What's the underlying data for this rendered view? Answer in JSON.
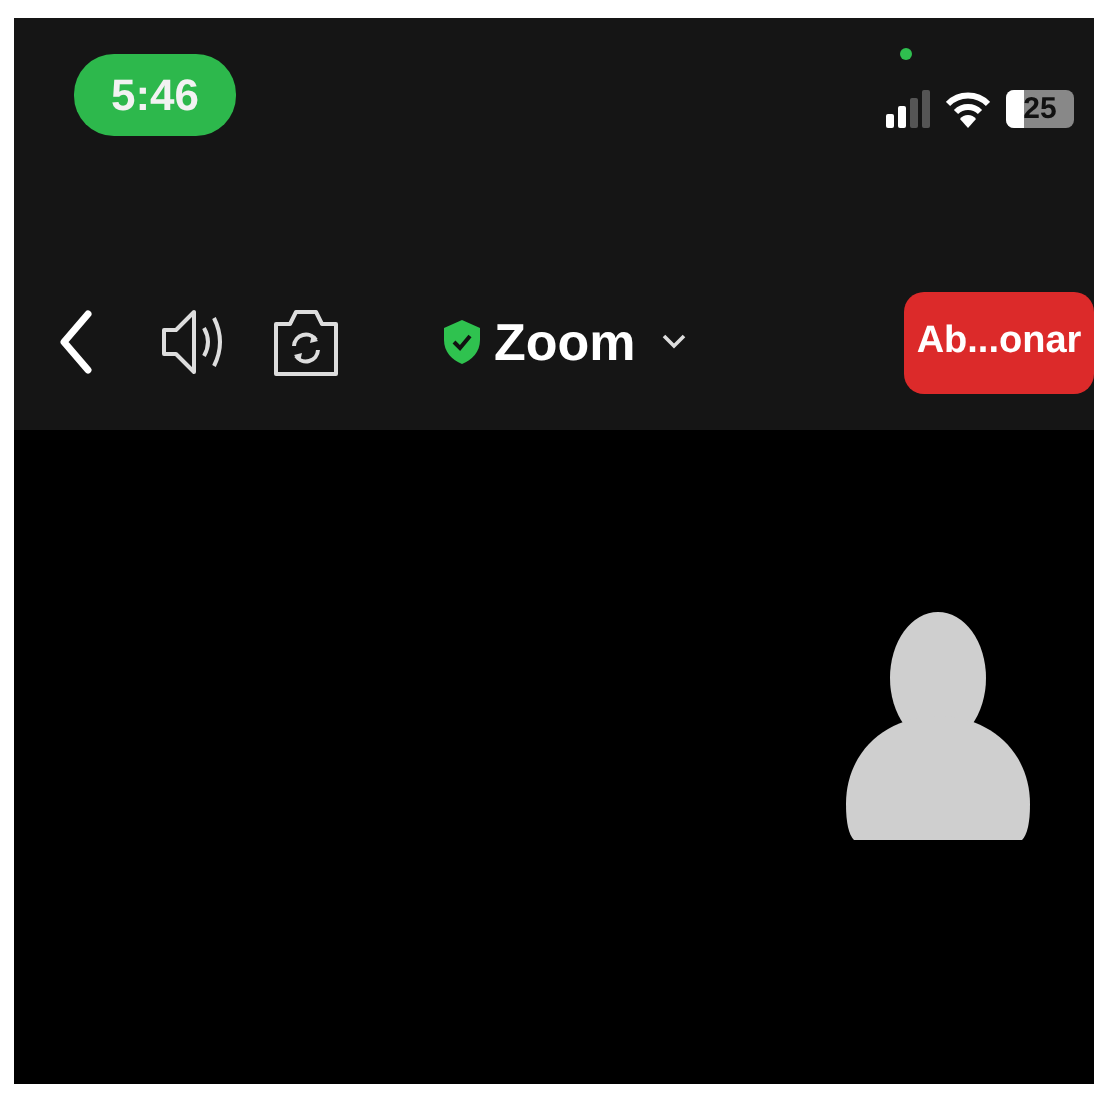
{
  "status_bar": {
    "time": "5:46",
    "battery": "25"
  },
  "toolbar": {
    "title": "Zoom",
    "verified": true,
    "leave_button": "Ab...onar"
  }
}
